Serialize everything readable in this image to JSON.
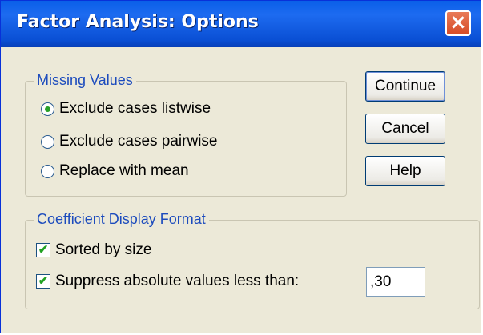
{
  "window": {
    "title": "Factor Analysis: Options",
    "close_icon": "×"
  },
  "missing_values": {
    "legend": "Missing Values",
    "options": [
      {
        "label": "Exclude cases listwise",
        "selected": true
      },
      {
        "label": "Exclude cases pairwise",
        "selected": false
      },
      {
        "label": "Replace with mean",
        "selected": false
      }
    ]
  },
  "coefficient_display": {
    "legend": "Coefficient Display Format",
    "sorted_by_size": {
      "label": "Sorted by size",
      "checked": true,
      "mark": "✔"
    },
    "suppress": {
      "label": "Suppress absolute values less than:",
      "checked": true,
      "mark": "✔",
      "value": ",30"
    }
  },
  "buttons": {
    "continue": "Continue",
    "cancel": "Cancel",
    "help": "Help"
  },
  "colors": {
    "title_bar": "#0a5fe8",
    "legend_text": "#1c4bbd",
    "dialog_bg": "#ece9d8",
    "check_mark": "#21a121"
  }
}
